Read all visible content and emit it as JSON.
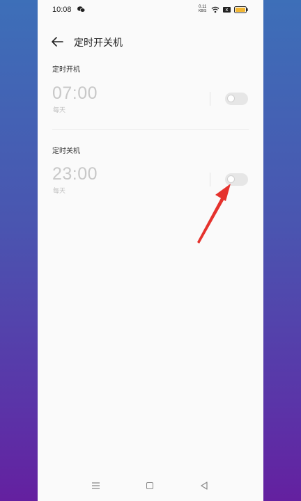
{
  "status_bar": {
    "time": "10:08",
    "net_speed_value": "0.11",
    "net_speed_unit": "KB/S",
    "sim_label": "x"
  },
  "header": {
    "title": "定时开关机"
  },
  "power_on": {
    "label": "定时开机",
    "time": "07:00",
    "repeat": "每天",
    "enabled": false
  },
  "power_off": {
    "label": "定时关机",
    "time": "23:00",
    "repeat": "每天",
    "enabled": false
  },
  "colors": {
    "annotation_arrow": "#e5322d",
    "battery": "#f2b631"
  }
}
